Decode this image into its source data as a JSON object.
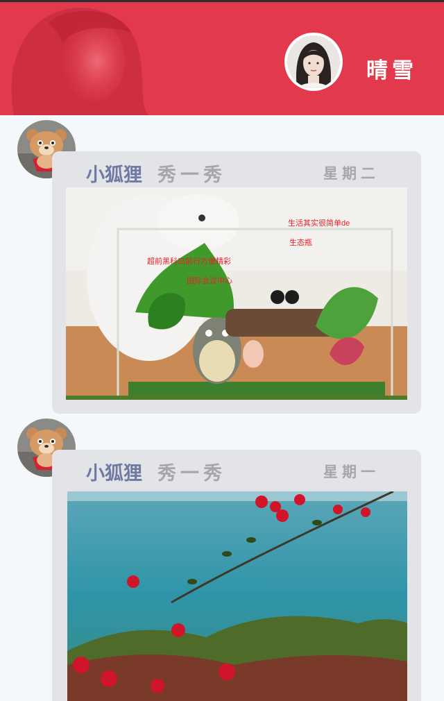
{
  "header": {
    "user_name": "晴雪"
  },
  "posts": [
    {
      "author": "小狐狸",
      "action": "秀一秀",
      "day": "星期二",
      "image_captions": [
        "生活其实很简单de",
        "生态瓶",
        "超前黑科曰前行方便精彩",
        "国际会议中心"
      ]
    },
    {
      "author": "小狐狸",
      "action": "秀一秀",
      "day": "星期一"
    }
  ],
  "colors": {
    "header_bg": "#e23a4c",
    "page_bg": "#f5f8fb",
    "card_bg": "#e3e4e8",
    "author_text": "#6e7aa1",
    "muted_text": "#a5a7ad"
  },
  "icons": {
    "header_avatar": "user-portrait-avatar",
    "post_avatar": "teddy-bear-avatar"
  }
}
